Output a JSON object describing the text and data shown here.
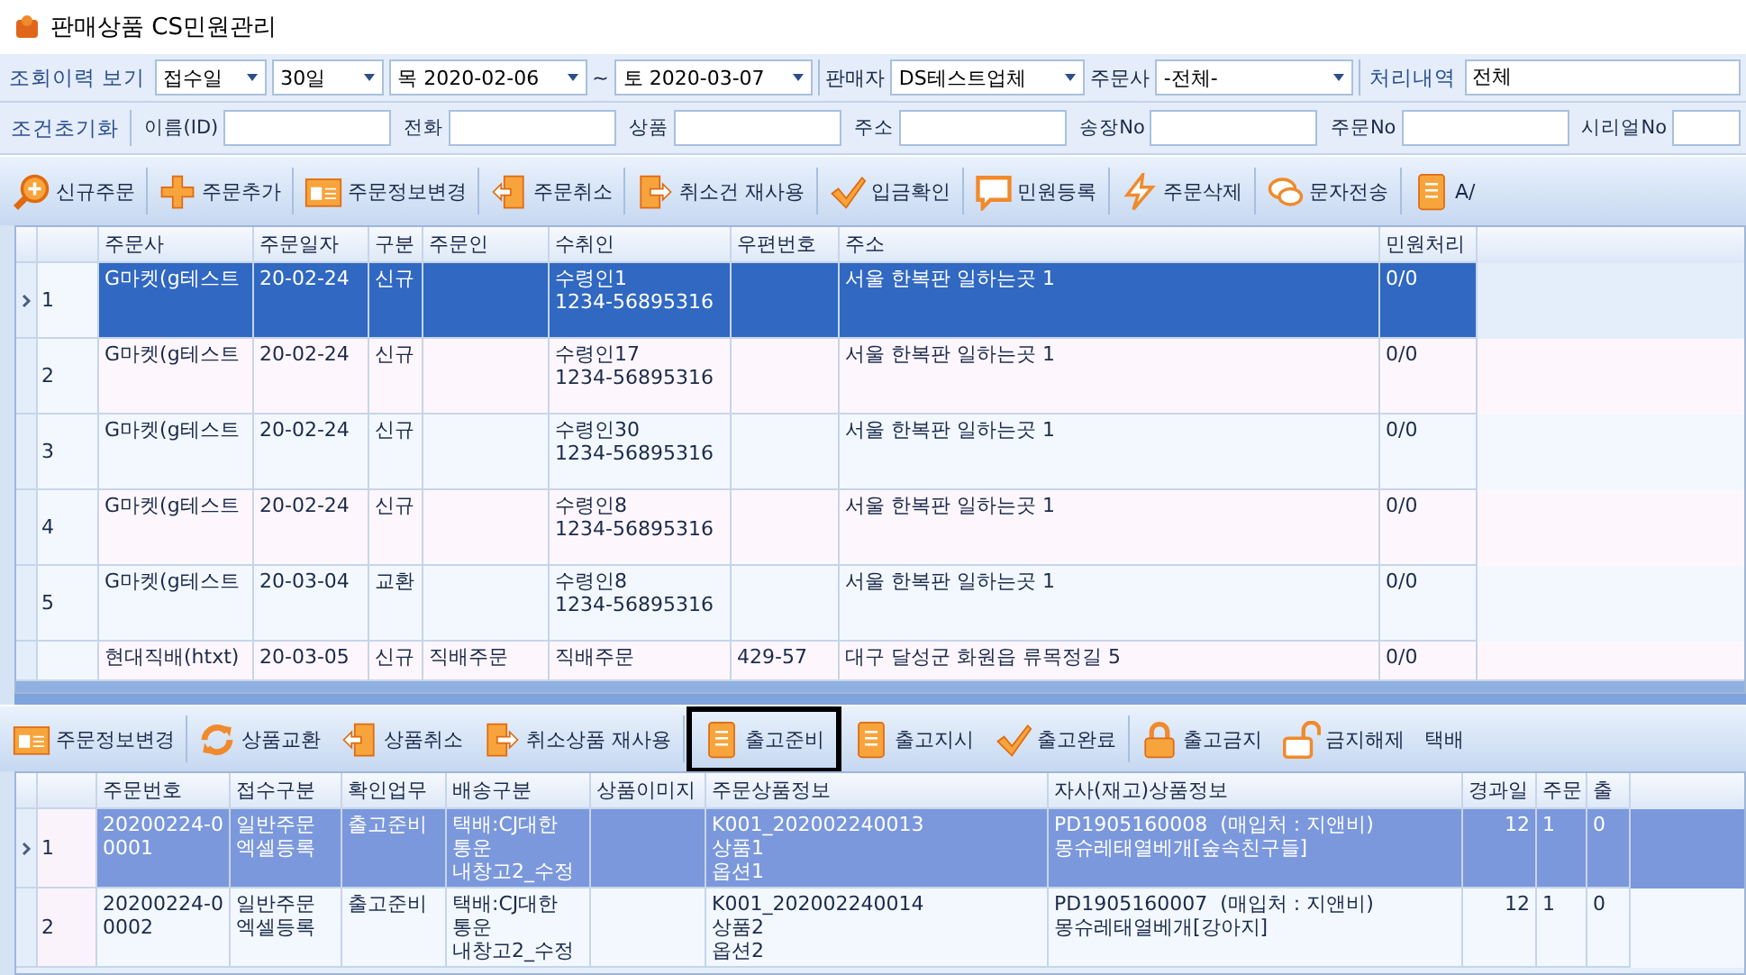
{
  "window": {
    "title": "판매상품 CS민원관리"
  },
  "filter_row": [
    {
      "kind": "caption",
      "text": "조회이력 보기"
    },
    {
      "kind": "dropdown",
      "value": "접수일"
    },
    {
      "kind": "dropdown",
      "value": "30일"
    },
    {
      "kind": "dropdown",
      "value": "목 2020-02-06"
    },
    {
      "kind": "text",
      "text": "~"
    },
    {
      "kind": "dropdown",
      "value": "토 2020-03-07"
    },
    {
      "kind": "sep"
    },
    {
      "kind": "label",
      "text": "판매자"
    },
    {
      "kind": "dropdown",
      "value": "DS테스트업체"
    },
    {
      "kind": "label",
      "text": "주문사"
    },
    {
      "kind": "dropdown",
      "value": "-전체-"
    },
    {
      "kind": "sep"
    },
    {
      "kind": "caption",
      "text": "처리내역"
    },
    {
      "kind": "field",
      "value": "전체"
    }
  ],
  "search_row": {
    "reset": "조건초기화",
    "fields": [
      {
        "label": "이름(ID)"
      },
      {
        "label": "전화"
      },
      {
        "label": "상품"
      },
      {
        "label": "주소"
      },
      {
        "label": "송장No"
      },
      {
        "label": "주문No"
      },
      {
        "label": "시리얼No"
      }
    ]
  },
  "toolbar": [
    {
      "label": "신규주문"
    },
    {
      "label": "주문추가"
    },
    {
      "label": "주문정보변경"
    },
    {
      "label": "주문취소"
    },
    {
      "label": "취소건 재사용"
    },
    {
      "label": "입금확인"
    },
    {
      "label": "민원등록"
    },
    {
      "label": "주문삭제"
    },
    {
      "label": "문자전송"
    },
    {
      "label": "A/"
    }
  ],
  "orders": {
    "columns": [
      "주문사",
      "주문일자",
      "구분",
      "주문인",
      "수취인",
      "우편번호",
      "주소",
      "민원처리"
    ],
    "rows": [
      {
        "num": "1",
        "selected": true,
        "cells": [
          "G마켓(g테스트",
          "20-02-24",
          "신규",
          "",
          "수령인1\n1234-56895316",
          "",
          "서울 한복판 일하는곳 1",
          "0/0"
        ]
      },
      {
        "num": "2",
        "selected": false,
        "cells": [
          "G마켓(g테스트",
          "20-02-24",
          "신규",
          "",
          "수령인17\n1234-56895316",
          "",
          "서울 한복판 일하는곳 1",
          "0/0"
        ]
      },
      {
        "num": "3",
        "selected": false,
        "cells": [
          "G마켓(g테스트",
          "20-02-24",
          "신규",
          "",
          "수령인30\n1234-56895316",
          "",
          "서울 한복판 일하는곳 1",
          "0/0"
        ]
      },
      {
        "num": "4",
        "selected": false,
        "cells": [
          "G마켓(g테스트",
          "20-02-24",
          "신규",
          "",
          "수령인8\n1234-56895316",
          "",
          "서울 한복판 일하는곳 1",
          "0/0"
        ]
      },
      {
        "num": "5",
        "selected": false,
        "cells": [
          "G마켓(g테스트",
          "20-03-04",
          "교환",
          "",
          "수령인8\n1234-56895316",
          "",
          "서울 한복판 일하는곳 1",
          "0/0"
        ]
      },
      {
        "selected": false,
        "cells": [
          "현대직배(htxt)",
          "20-03-05",
          "신규",
          "직배주문",
          "직배주문",
          "429-57",
          "대구 달성군 화원읍 류목정길 5",
          "0/0"
        ]
      }
    ]
  },
  "toolbar2": [
    {
      "label": "주문정보변경",
      "highlighted": false
    },
    {
      "label": "상품교환",
      "highlighted": false
    },
    {
      "label": "상품취소",
      "highlighted": false
    },
    {
      "label": "취소상품 재사용",
      "highlighted": false
    },
    {
      "label": "출고준비",
      "highlighted": true
    },
    {
      "label": "출고지시",
      "highlighted": false
    },
    {
      "label": "출고완료",
      "highlighted": false
    },
    {
      "label": "출고금지",
      "highlighted": false
    },
    {
      "label": "금지해제",
      "highlighted": false
    },
    {
      "label": "택배",
      "highlighted": false
    }
  ],
  "items": {
    "columns": [
      "주문번호",
      "접수구분",
      "확인업무",
      "배송구분",
      "상품이미지",
      "주문상품정보",
      "자사(재고)상품정보",
      "경과일",
      "주문",
      "출"
    ],
    "rows": [
      {
        "num": "1",
        "selected": true,
        "cells": [
          "20200224-0\n0001",
          "일반주문\n엑셀등록",
          "출고준비",
          "택배:CJ대한\n통운\n내창고2_수정",
          "",
          "K001_202002240013\n상품1\n옵션1",
          "PD1905160008  (매입처 : 지앤비)\n몽슈레태열베개[숲속친구들]",
          "12",
          "1",
          "0"
        ]
      },
      {
        "num": "2",
        "selected": false,
        "cells": [
          "20200224-0\n0002",
          "일반주문\n엑셀등록",
          "출고준비",
          "택배:CJ대한\n통운\n내창고2_수정",
          "",
          "K001_202002240014\n상품2\n옵션2",
          "PD1905160007  (매입처 : 지앤비)\n몽슈레태열베개[강아지]",
          "12",
          "1",
          "0"
        ]
      }
    ]
  }
}
